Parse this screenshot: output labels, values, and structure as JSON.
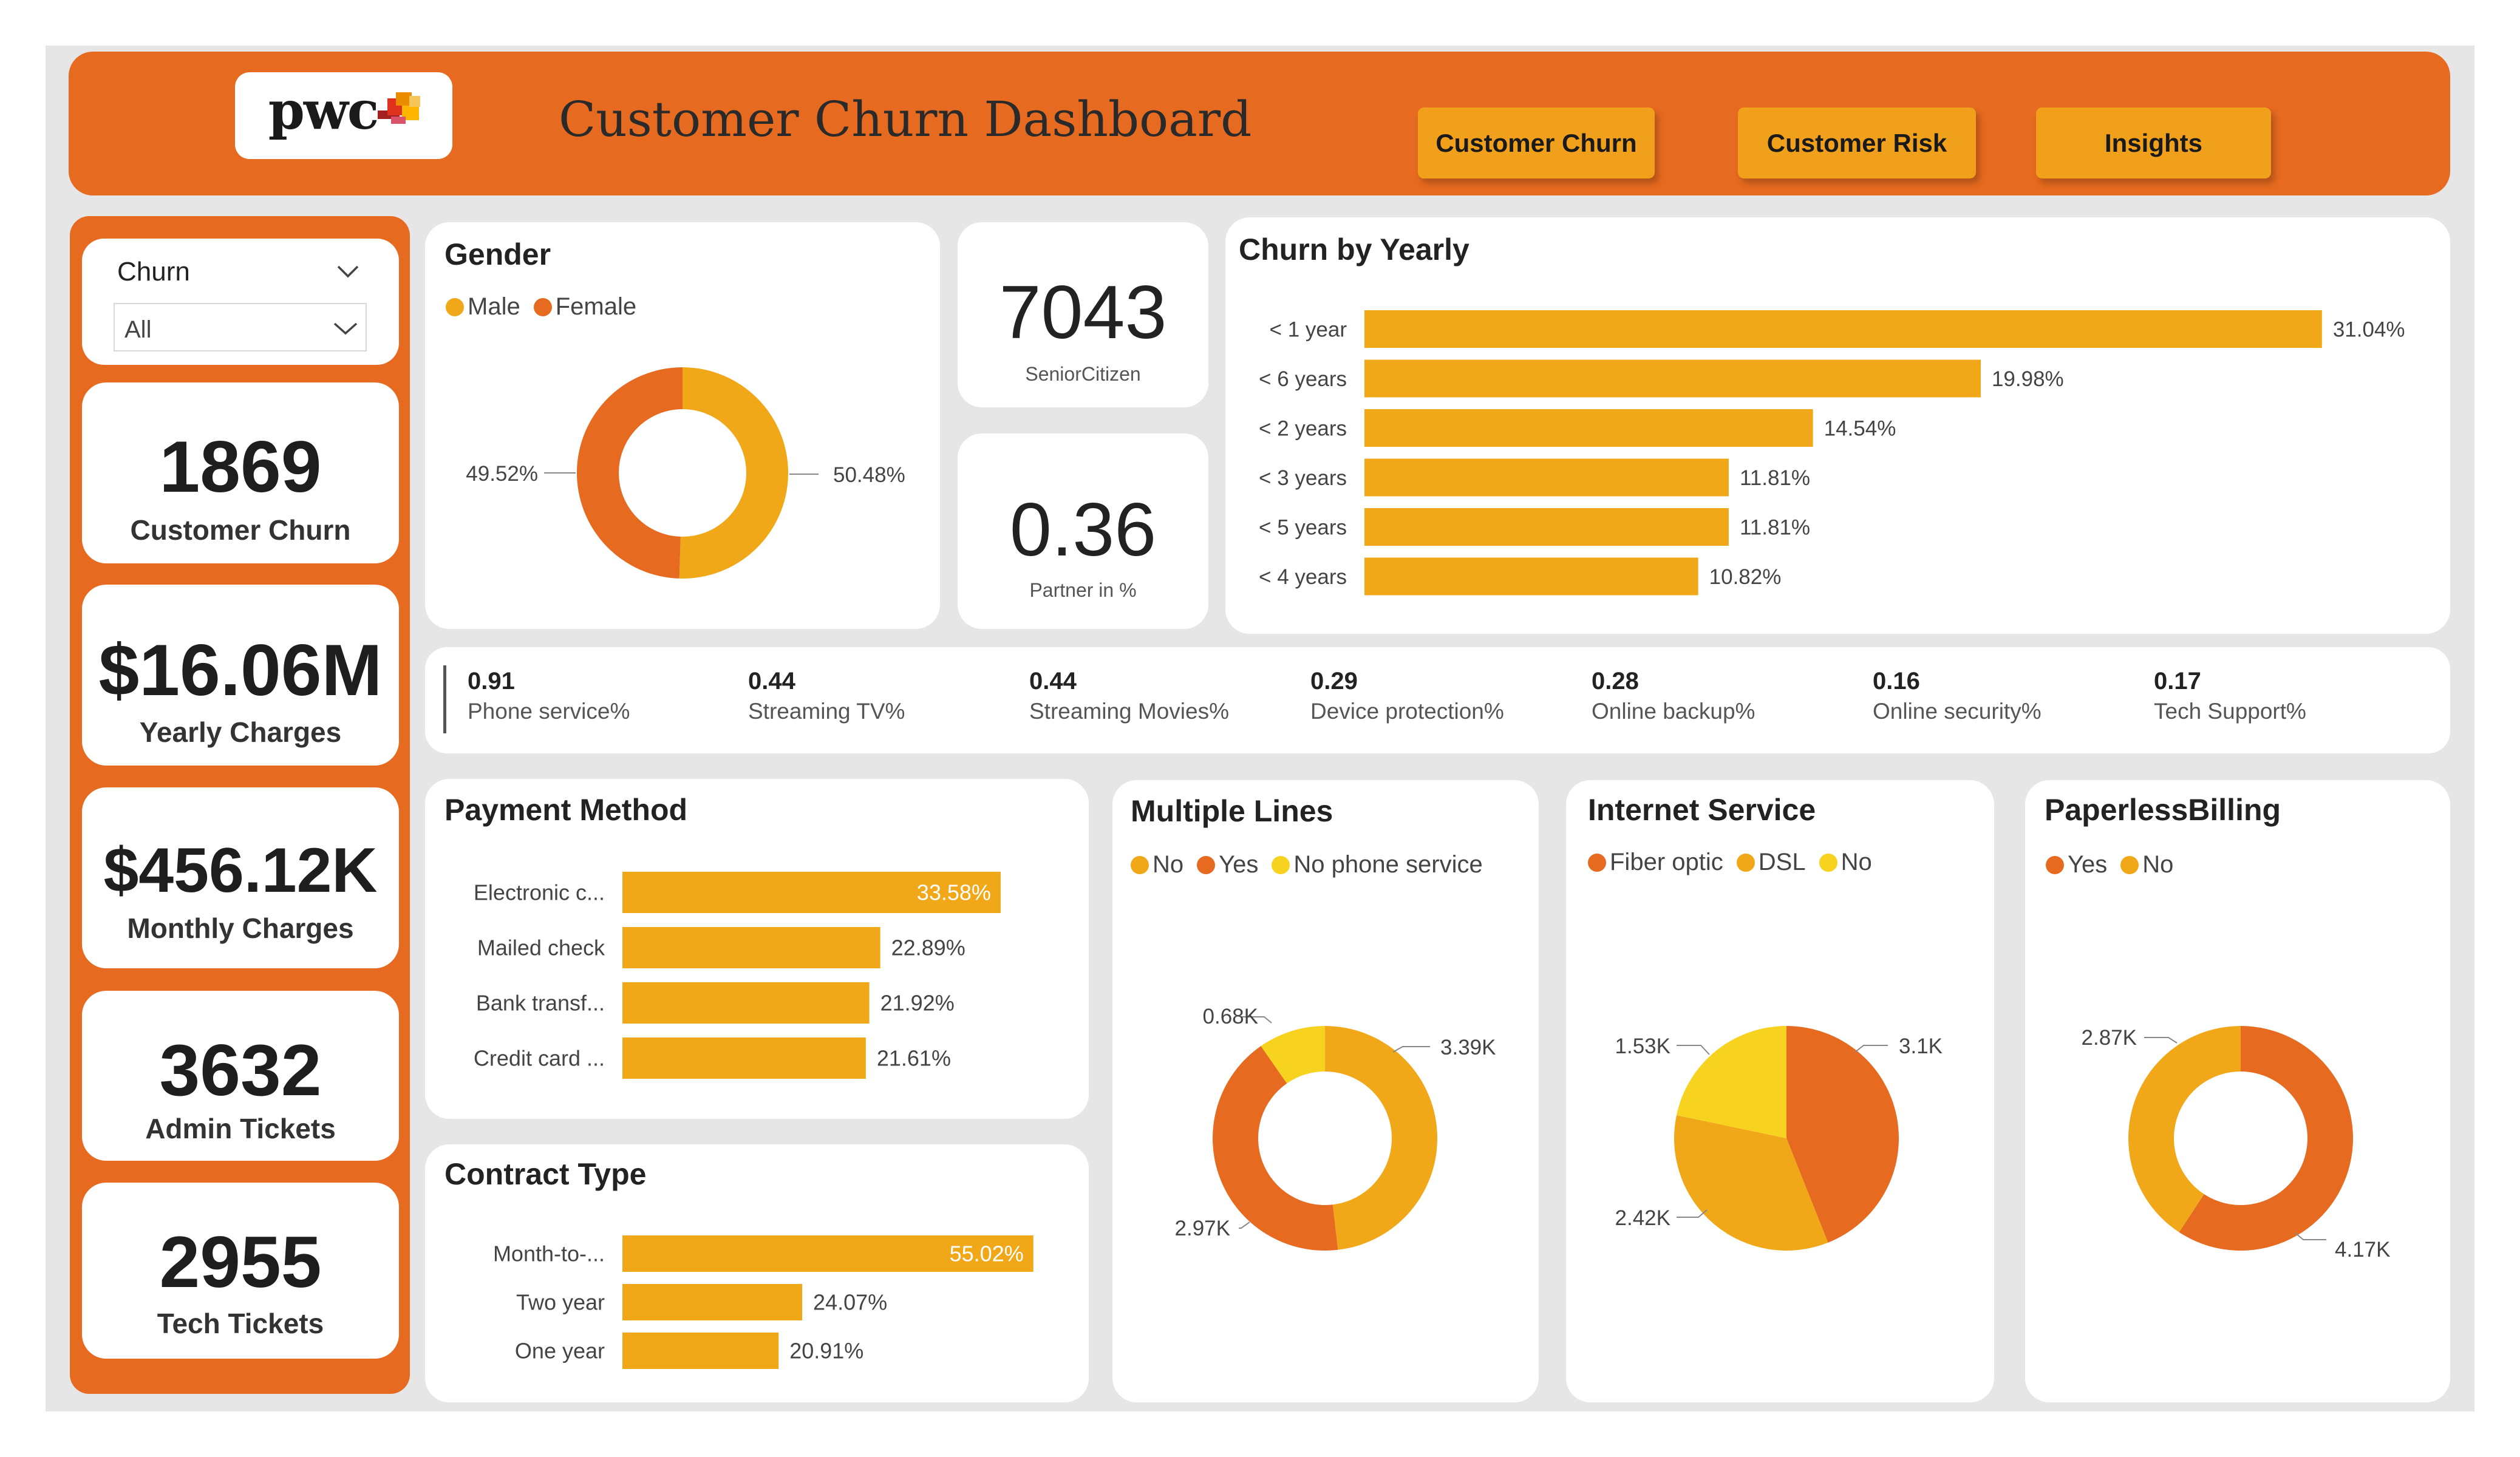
{
  "header": {
    "logo_text": "pwc",
    "title": "Customer Churn Dashboard",
    "nav": [
      "Customer Churn",
      "Customer Risk",
      "Insights"
    ]
  },
  "filter": {
    "label": "Churn",
    "value": "All"
  },
  "kpis": [
    {
      "value": "1869",
      "label": "Customer Churn"
    },
    {
      "value": "$16.06M",
      "label": "Yearly Charges"
    },
    {
      "value": "$456.12K",
      "label": "Monthly Charges"
    },
    {
      "value": "3632",
      "label": "Admin Tickets"
    },
    {
      "value": "2955",
      "label": "Tech Tickets"
    }
  ],
  "cards": [
    {
      "value": "7043",
      "label": "SeniorCitizen"
    },
    {
      "value": "0.36",
      "label": "Partner in %"
    }
  ],
  "services": [
    {
      "value": "0.91",
      "label": "Phone service%"
    },
    {
      "value": "0.44",
      "label": "Streaming TV%"
    },
    {
      "value": "0.44",
      "label": "Streaming Movies%"
    },
    {
      "value": "0.29",
      "label": "Device protection%"
    },
    {
      "value": "0.28",
      "label": "Online backup%"
    },
    {
      "value": "0.16",
      "label": "Online security%"
    },
    {
      "value": "0.17",
      "label": "Tech Support%"
    }
  ],
  "colors": {
    "orange": "#e66a1f",
    "amber": "#f0a818",
    "yellow": "#f7d21e"
  },
  "chart_data": [
    {
      "id": "gender",
      "type": "donut",
      "title": "Gender",
      "legend": [
        "Male",
        "Female"
      ],
      "values": [
        50.48,
        49.52
      ],
      "labels": [
        "50.48%",
        "49.52%"
      ],
      "colors": [
        "#f0a818",
        "#e66a1f"
      ]
    },
    {
      "id": "yearly",
      "type": "bar",
      "title": "Churn by Yearly",
      "categories": [
        "< 1 year",
        "< 6 years",
        "< 2 years",
        "< 3 years",
        "< 5 years",
        "< 4 years"
      ],
      "values": [
        31.04,
        19.98,
        14.54,
        11.81,
        11.81,
        10.82
      ],
      "labels": [
        "31.04%",
        "19.98%",
        "14.54%",
        "11.81%",
        "11.81%",
        "10.82%"
      ]
    },
    {
      "id": "payment",
      "type": "bar",
      "title": "Payment Method",
      "categories": [
        "Electronic c...",
        "Mailed check",
        "Bank transf...",
        "Credit card ..."
      ],
      "values": [
        33.58,
        22.89,
        21.92,
        21.61
      ],
      "labels": [
        "33.58%",
        "22.89%",
        "21.92%",
        "21.61%"
      ]
    },
    {
      "id": "contract",
      "type": "bar",
      "title": "Contract Type",
      "categories": [
        "Month-to-...",
        "Two year",
        "One year"
      ],
      "values": [
        55.02,
        24.07,
        20.91
      ],
      "labels": [
        "55.02%",
        "24.07%",
        "20.91%"
      ]
    },
    {
      "id": "multiple",
      "type": "donut",
      "title": "Multiple Lines",
      "legend": [
        "No",
        "Yes",
        "No phone service"
      ],
      "values": [
        3.39,
        2.97,
        0.68
      ],
      "labels": [
        "3.39K",
        "2.97K",
        "0.68K"
      ],
      "colors": [
        "#f0a818",
        "#e66a1f",
        "#f7d21e"
      ]
    },
    {
      "id": "internet",
      "type": "pie",
      "title": "Internet Service",
      "legend": [
        "Fiber optic",
        "DSL",
        "No"
      ],
      "values": [
        3.1,
        2.42,
        1.53
      ],
      "labels": [
        "3.1K",
        "2.42K",
        "1.53K"
      ],
      "colors": [
        "#e66a1f",
        "#f0a818",
        "#f7d21e"
      ]
    },
    {
      "id": "paperless",
      "type": "donut",
      "title": "PaperlessBilling",
      "legend": [
        "Yes",
        "No"
      ],
      "values": [
        4.17,
        2.87
      ],
      "labels": [
        "4.17K",
        "2.87K"
      ],
      "colors": [
        "#e66a1f",
        "#f0a818"
      ]
    }
  ]
}
